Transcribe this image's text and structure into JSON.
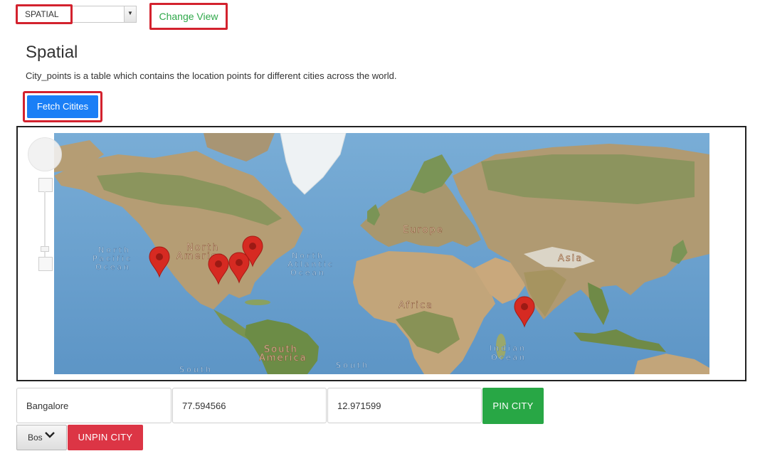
{
  "top_bar": {
    "view_select_value": "SPATIAL",
    "change_view_label": "Change View"
  },
  "page": {
    "title": "Spatial",
    "description": "City_points is a table which contains the location points for different cities across the world.",
    "fetch_button_label": "Fetch Citites"
  },
  "map": {
    "labels": {
      "north_america": [
        "North",
        "America"
      ],
      "north_pacific": [
        "North",
        "Pacific",
        "Ocean"
      ],
      "north_atlantic": [
        "North",
        "Atlantic",
        "Ocean"
      ],
      "europe": "Europe",
      "asia": "Asia",
      "africa": "Africa",
      "south_america": [
        "South",
        "America"
      ],
      "indian_ocean": [
        "Indian",
        "Ocean"
      ],
      "south_pacific": "South",
      "south_atlantic": "South"
    },
    "colors": {
      "ocean": "#6fa3cf",
      "land": "#b9a27a",
      "vegetation": "#6f8f4f",
      "ice": "#eef2f4",
      "marker": "#d62a22",
      "accent_highlight": "#d3222e"
    }
  },
  "form": {
    "city_name": "Bangalore",
    "longitude": "77.594566",
    "latitude": "12.971599",
    "pin_label": "PIN CITY",
    "city_select_value": "Bos",
    "unpin_label": "UNPIN CITY"
  }
}
